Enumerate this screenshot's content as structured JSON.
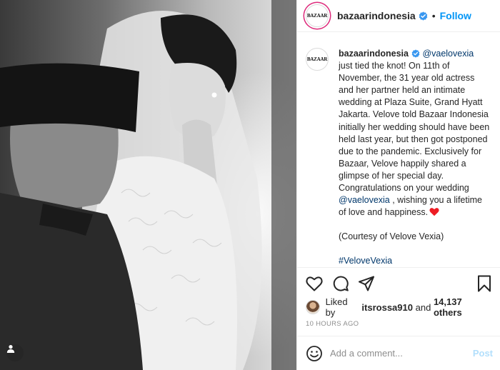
{
  "post": {
    "account": {
      "username": "bazaarindonesia",
      "avatar_text": "BAZAAR",
      "verified": true,
      "follow_label": "Follow",
      "separator": "•"
    },
    "caption": {
      "mention_1": "@vaelovexia",
      "text_1": " just tied the knot! On 11th of November, the 31 year old actress and her partner held an intimate wedding at Plaza Suite, Grand Hyatt Jakarta. Velove told Bazaar Indonesia initially her wedding should have been held last year, but then got postponed due to the pandemic. Exclusively for Bazaar, Velove happily shared a glimpse of her special day. Congratulations on your wedding ",
      "mention_2": "@vaelovexia",
      "text_2": " , wishing you a lifetime of love and happiness.",
      "emoji": "red-heart",
      "courtesy": "(Courtesy of Velove Vexia)",
      "hashtag": "#VeloveVexia",
      "time": "10h"
    },
    "likes": {
      "prefix": "Liked by",
      "user": "itsrossa910",
      "joiner": "and",
      "others": "14,137 others"
    },
    "timestamp": "10 HOURS AGO",
    "comment": {
      "placeholder": "Add a comment...",
      "post_label": "Post"
    },
    "icons": {
      "like": "heart-outline-icon",
      "comment": "comment-bubble-icon",
      "share": "paper-plane-icon",
      "save": "bookmark-icon",
      "emoji": "smiley-icon",
      "tag": "user-tag-icon"
    },
    "colors": {
      "link": "#00376b",
      "follow": "#0095f6",
      "post_disabled": "#b2dffc",
      "heart": "#ed1c24"
    }
  }
}
